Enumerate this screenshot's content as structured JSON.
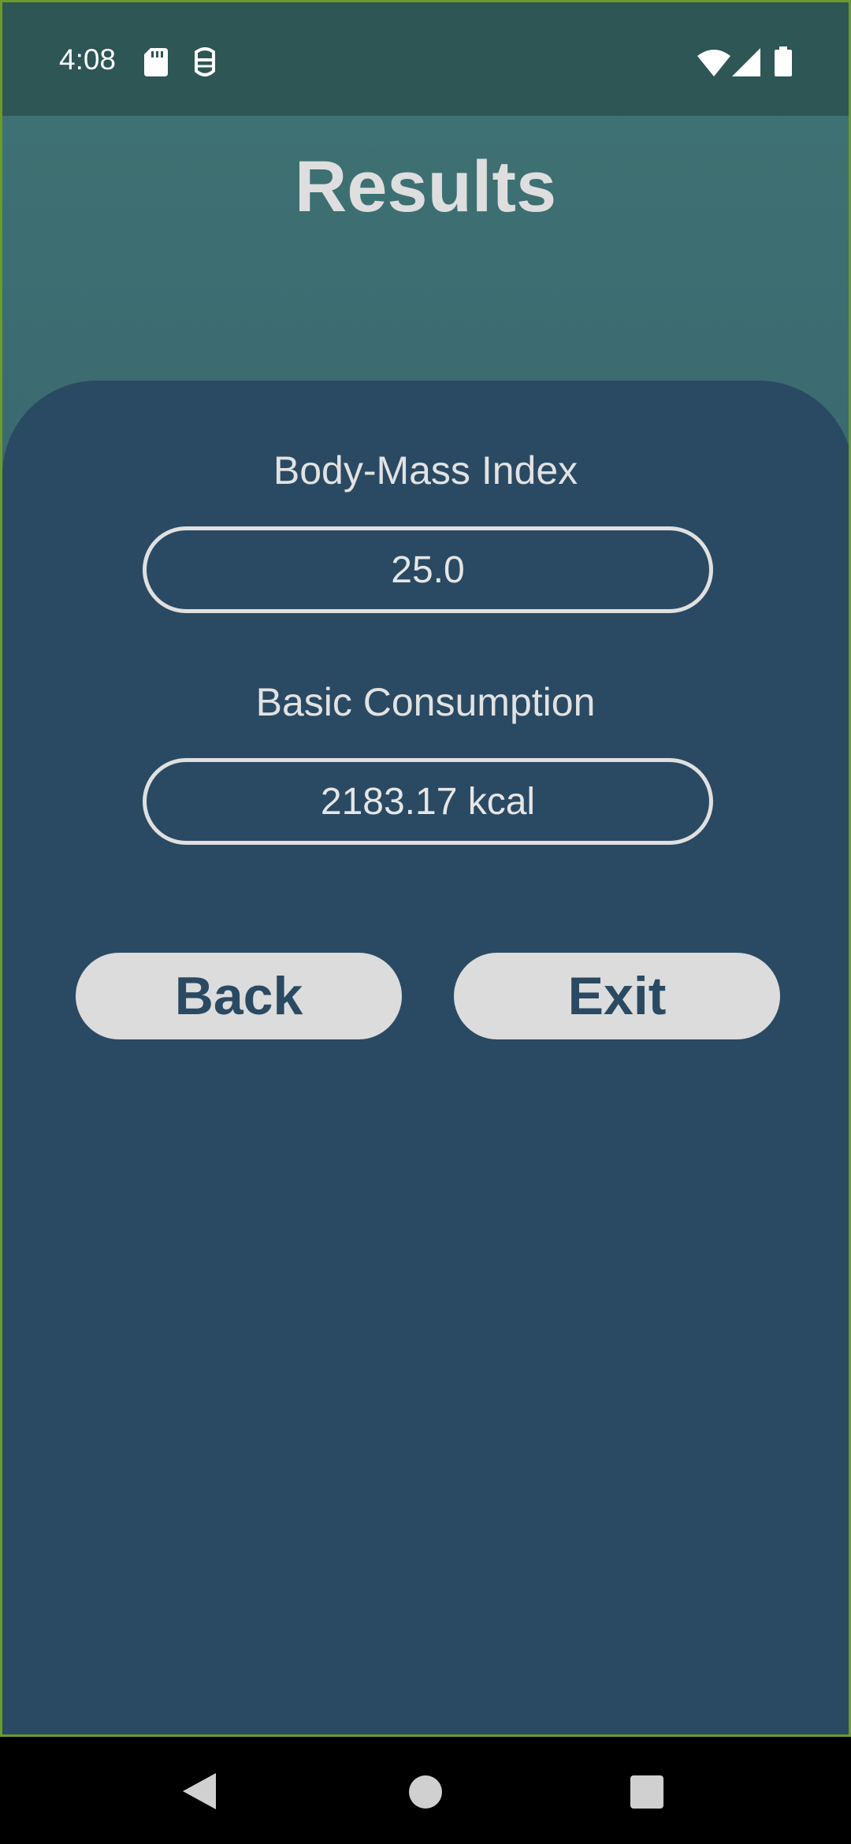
{
  "status_bar": {
    "time": "4:08",
    "icons": [
      "sd-card-icon",
      "assistant-icon",
      "wifi-icon",
      "signal-icon",
      "battery-icon"
    ]
  },
  "page": {
    "title": "Results"
  },
  "fields": {
    "bmi": {
      "label": "Body-Mass Index",
      "value": "25.0"
    },
    "consumption": {
      "label": "Basic Consumption",
      "value": "2183.17 kcal"
    }
  },
  "buttons": {
    "back_label": "Back",
    "exit_label": "Exit"
  },
  "navigation": {
    "icons": [
      "back-icon",
      "home-icon",
      "recents-icon"
    ]
  },
  "colors": {
    "header_background": "#2d5655",
    "card_background": "#2a4a63",
    "button_background": "#dcdcdc",
    "button_text": "#2a4a63",
    "title_text": "#dedede",
    "frame_border": "#6b9b2a"
  }
}
